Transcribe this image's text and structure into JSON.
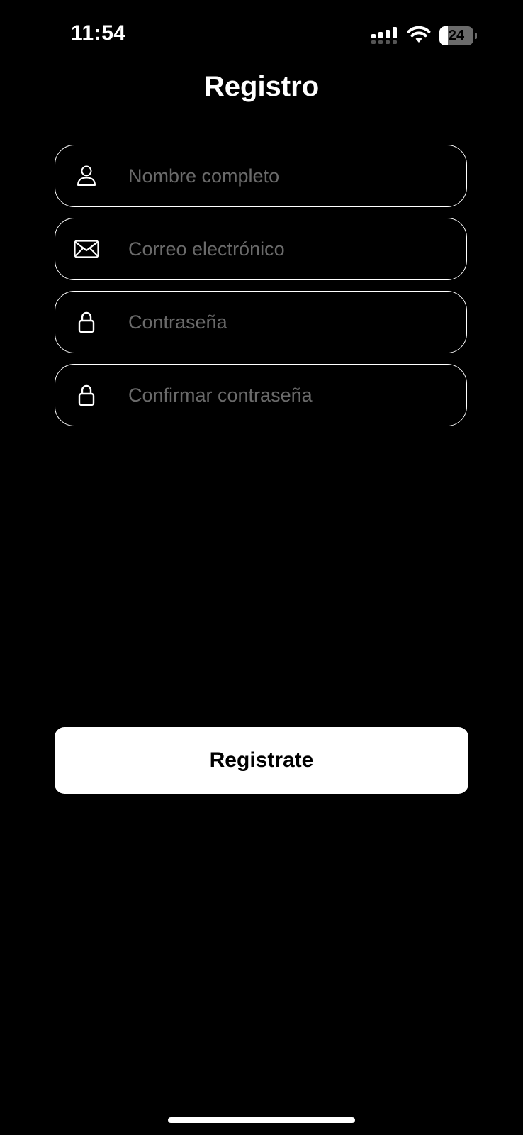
{
  "status_bar": {
    "time": "11:54",
    "battery_level": "24",
    "battery_fraction": 0.24,
    "icons": [
      "signal-icon",
      "wifi-icon",
      "battery-icon"
    ]
  },
  "page": {
    "title": "Registro"
  },
  "form": {
    "fields": [
      {
        "icon": "person-icon",
        "placeholder": "Nombre completo",
        "value": ""
      },
      {
        "icon": "envelope-icon",
        "placeholder": "Correo electrónico",
        "value": ""
      },
      {
        "icon": "lock-icon",
        "placeholder": "Contraseña",
        "value": ""
      },
      {
        "icon": "lock-icon",
        "placeholder": "Confirmar contraseña",
        "value": ""
      }
    ]
  },
  "actions": {
    "register_label": "Registrate"
  },
  "colors": {
    "background": "#000000",
    "foreground": "#ffffff",
    "placeholder": "#6a6a6a",
    "button_background": "#ffffff",
    "button_text": "#000000"
  }
}
